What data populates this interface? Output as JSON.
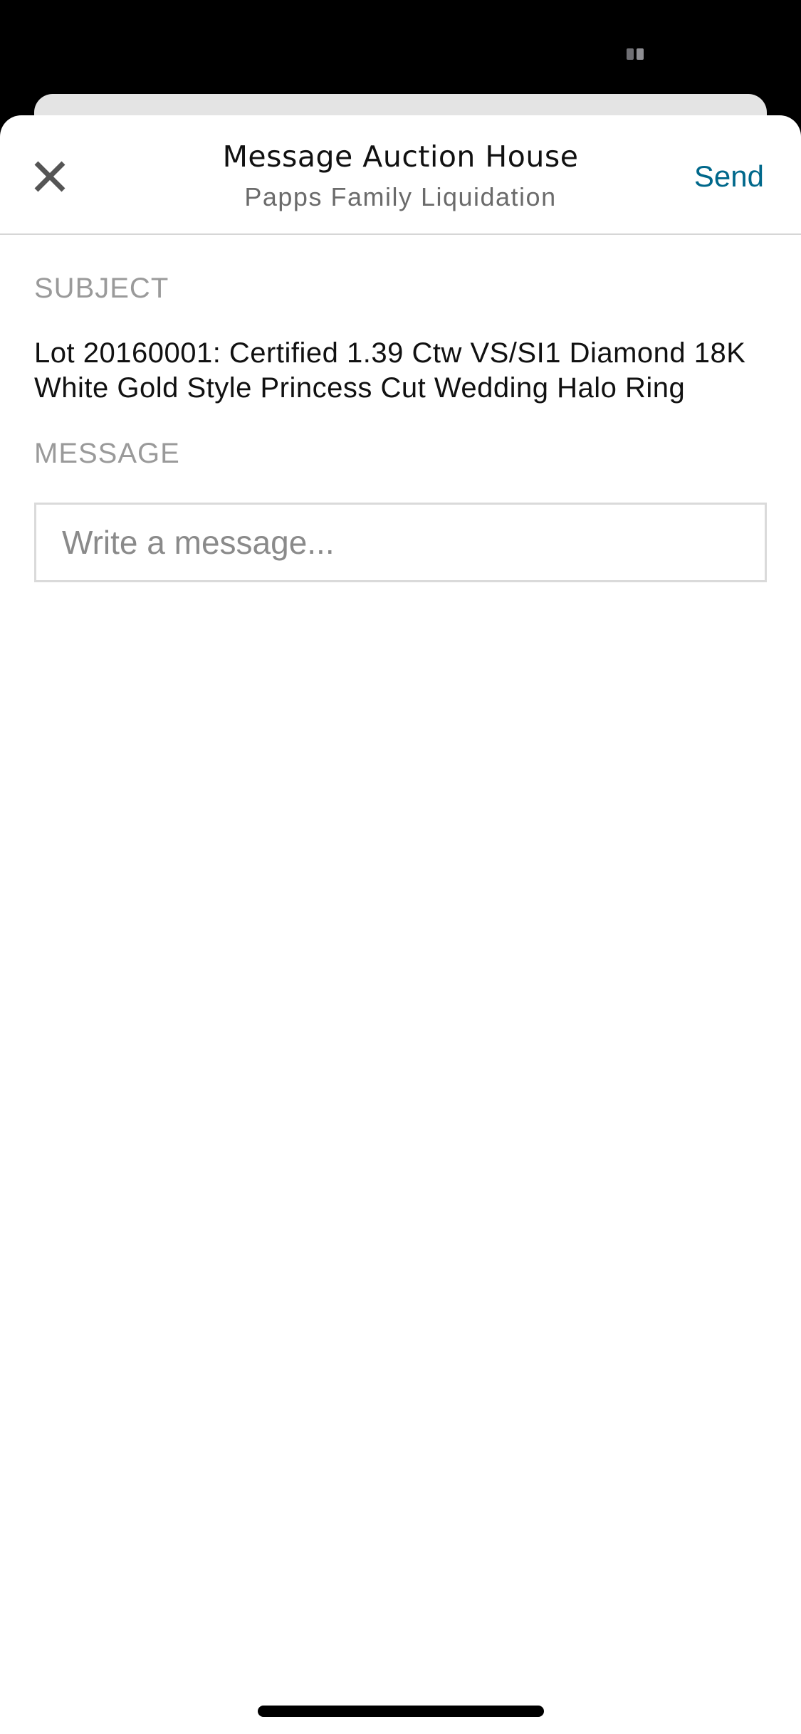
{
  "header": {
    "title": "Message Auction House",
    "subtitle": "Papps Family Liquidation",
    "send_label": "Send",
    "close_icon": "close-icon"
  },
  "form": {
    "subject_label": "SUBJECT",
    "subject_value": "Lot 20160001: Certified 1.39 Ctw VS/SI1 Diamond 18K White Gold Style Princess Cut Wedding Halo Ring",
    "message_label": "MESSAGE",
    "message_placeholder": "Write a message...",
    "message_value": ""
  },
  "colors": {
    "accent": "#00688b",
    "label_gray": "#9a9a9a",
    "divider": "#d6d6d6"
  }
}
